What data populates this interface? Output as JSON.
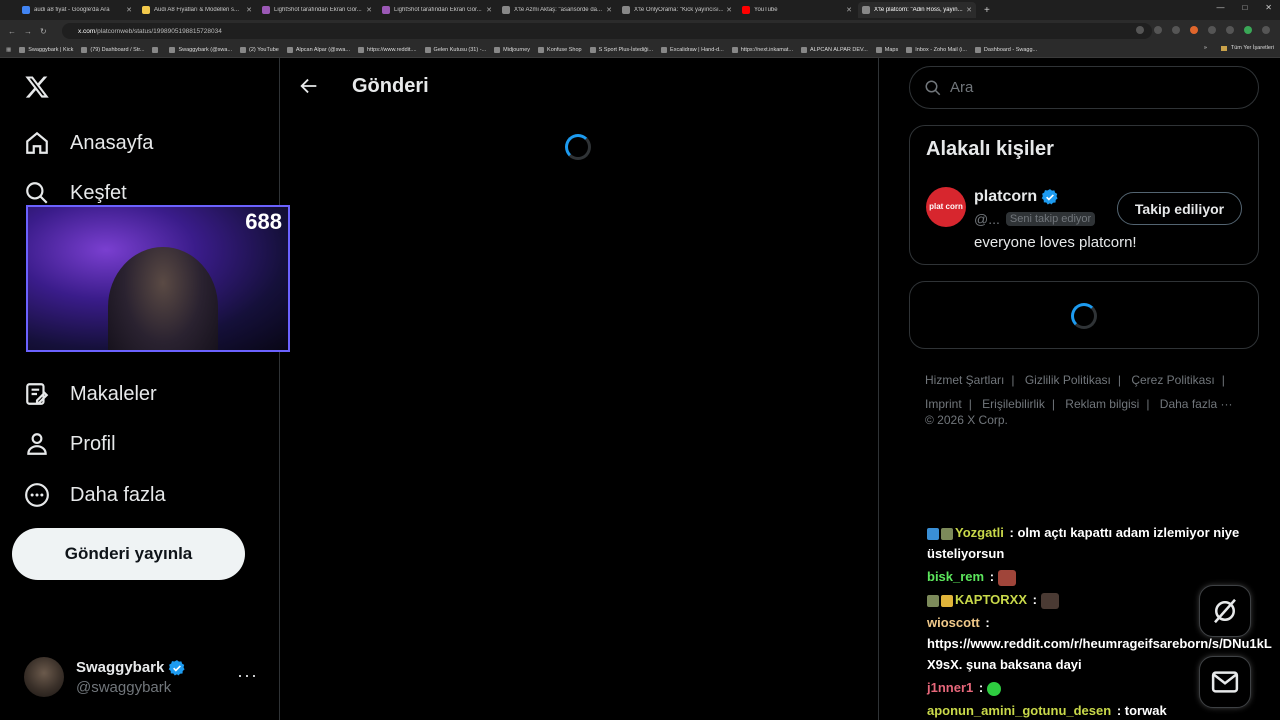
{
  "browser": {
    "tabs": [
      {
        "label": "audi a8 fiyat - Google'da Ara",
        "color": "#4285f4",
        "active": false
      },
      {
        "label": "Audi A8 Fiyatları & Modelleri s...",
        "color": "#f2c94c",
        "active": false
      },
      {
        "label": "LightShot tarafından Ekran Gör...",
        "color": "#9b59b6",
        "active": false
      },
      {
        "label": "LightShot tarafından Ekran Gör...",
        "color": "#9b59b6",
        "active": false
      },
      {
        "label": "X'te Azmi Aktaş: \"asansörde da...",
        "color": "#888888",
        "active": false
      },
      {
        "label": "X'te OnlyOrama: \"Kick yayıncısı...",
        "color": "#888888",
        "active": false
      },
      {
        "label": "YouTube",
        "color": "#ff0000",
        "active": false
      },
      {
        "label": "X'te platcorn: \"Adin Ross, yayın...",
        "color": "#888888",
        "active": true
      }
    ],
    "new_tab": "+",
    "url_host": "x.com",
    "url_path": "/platcornweb/status/1998905198815728034",
    "bookmarks": [
      "Swaggybark | Kick",
      "(79) Dashboard / Str...",
      "",
      "Swaggybark (@swa...",
      "(2) YouTube",
      "Alpcan Alpar (@swa...",
      "https://www.reddit....",
      "Gelen Kutusu (31) -...",
      "Midjourney",
      "Konfuse Shop",
      "S Sport Plus-İstediği...",
      "Excalidraw | Hand-d...",
      "https://next.inkamat...",
      "ALPCAN ALPAR DEV...",
      "Maps",
      "Inbox - Zoho Mail (i...",
      "Dashboard - Swagg..."
    ],
    "bookmarks_more": "»",
    "all_bookmarks": "Tüm Yer İşaretleri"
  },
  "nav": {
    "items": [
      {
        "label": "Anasayfa",
        "icon": "home-icon"
      },
      {
        "label": "Keşfet",
        "icon": "search-icon"
      },
      {
        "label": "Makaleler",
        "icon": "articles-icon"
      },
      {
        "label": "Profil",
        "icon": "profile-icon"
      },
      {
        "label": "Daha fazla",
        "icon": "more-circle-icon"
      }
    ],
    "post_button": "Gönderi yayınla"
  },
  "account": {
    "name": "Swaggybark",
    "handle": "@swaggybark",
    "more": "···"
  },
  "main": {
    "title": "Gönderi"
  },
  "webcam": {
    "viewer_count": "688"
  },
  "sidebar": {
    "search_placeholder": "Ara",
    "related": {
      "title": "Alakalı kişiler",
      "avatar_text": "plat corn",
      "name": "platcorn",
      "handle": "@...",
      "follows_you": "Seni takip ediyor",
      "bio": "everyone loves platcorn!",
      "follow_button": "Takip ediliyor"
    },
    "footer": {
      "links": [
        "Hizmet Şartları",
        "Gizlilik Politikası",
        "Çerez Politikası",
        "Imprint",
        "Erişilebilirlik",
        "Reklam bilgisi",
        "Daha fazla ···"
      ],
      "copyright": "© 2026 X Corp."
    }
  },
  "chat": {
    "messages": [
      {
        "user": "Yozgatli",
        "user_color": "#c9d94a",
        "sep": ":",
        "text": "olm açtı kapattı adam izlemiyor niye üsteliyorsun"
      },
      {
        "user": "bisk_rem",
        "user_color": "#5ce65c",
        "sep": ":",
        "text": ""
      },
      {
        "user": "KAPTORXX",
        "user_color": "#c9d94a",
        "sep": ":",
        "text": ""
      },
      {
        "user": "wioscott",
        "user_color": "#f0c98a",
        "sep": ":",
        "text": "https://www.reddit.com/r/heumrageifsareborn/s/DNu1kLX9sX. şuna baksana dayi"
      },
      {
        "user": "j1nner1",
        "user_color": "#e6677a",
        "sep": ":",
        "text": ""
      },
      {
        "user": "aponun_amini_gotunu_desen",
        "user_color": "#c9d94a",
        "sep": ":",
        "text": "torwak"
      }
    ]
  },
  "colors": {
    "accent": "#1d9bf0",
    "verified": "#1d9bf0",
    "background": "#000000",
    "border": "#2f3336"
  }
}
